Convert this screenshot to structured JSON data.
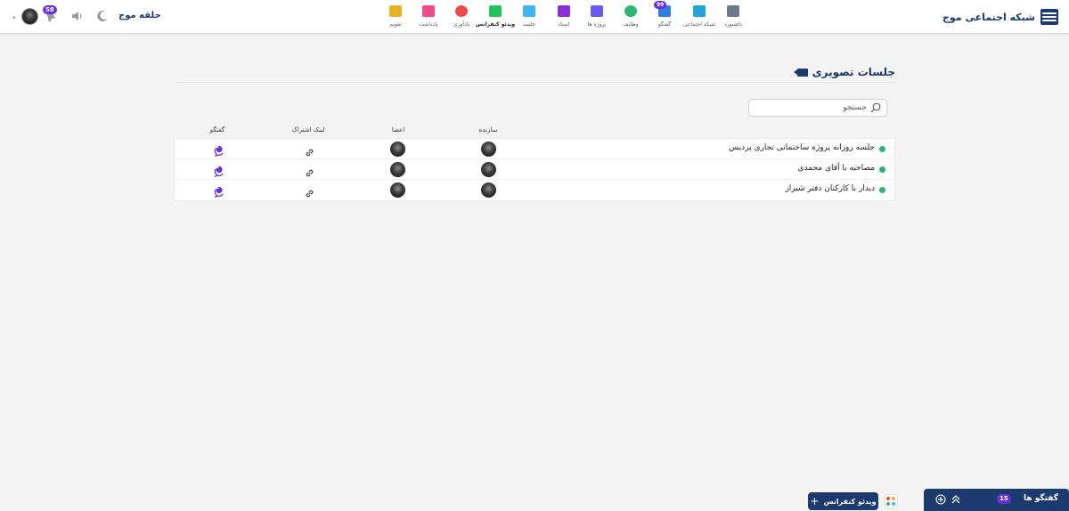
{
  "brand": {
    "name": "شبکه اجتماعی موج",
    "color": "#1d3a6e"
  },
  "header": {
    "circle_name": "حلقه موج",
    "notifications_count": "58",
    "nav": [
      {
        "key": "dashboard",
        "label": "داشبورد",
        "color": "#6b7a8c",
        "bold": false,
        "badge": ""
      },
      {
        "key": "social",
        "label": "شبکه اجتماعی",
        "color": "#1fa6d6",
        "bold": false,
        "badge": ""
      },
      {
        "key": "chat",
        "label": "گفتگو",
        "color": "#2f7de1",
        "bold": false,
        "badge": "99"
      },
      {
        "key": "tasks",
        "label": "وظایف",
        "color": "#2bb673",
        "bold": false,
        "badge": ""
      },
      {
        "key": "projects",
        "label": "پروژه ها",
        "color": "#6a5cf0",
        "bold": false,
        "badge": ""
      },
      {
        "key": "documents",
        "label": "اسناد",
        "color": "#8b2fd8",
        "bold": false,
        "badge": ""
      },
      {
        "key": "meeting",
        "label": "جلسه",
        "color": "#3eb5f1",
        "bold": false,
        "badge": ""
      },
      {
        "key": "videoconference",
        "label": "ویدئو کنفرانس",
        "color": "#22c35e",
        "bold": true,
        "badge": ""
      },
      {
        "key": "reminder",
        "label": "یادآوری",
        "color": "#ef4b4b",
        "bold": false,
        "badge": ""
      },
      {
        "key": "notes",
        "label": "یادداشت",
        "color": "#ee4d8c",
        "bold": false,
        "badge": ""
      },
      {
        "key": "calendar",
        "label": "تقویم",
        "color": "#e6b422",
        "bold": false,
        "badge": ""
      }
    ]
  },
  "page": {
    "title": "جلسات تصویری",
    "search_placeholder": "جستجو",
    "columns": {
      "creator": "سازنده",
      "members": "اعضا",
      "share_link": "لینک اشتراک",
      "chat": "گفتگو"
    },
    "rows": [
      {
        "title": "جلسه روزانه پروژه ساختمانی تجاری پردیس",
        "chat_count": "1"
      },
      {
        "title": "مصاحبه با آقای محمدی",
        "chat_count": "1"
      },
      {
        "title": "دیدار با کارکنان دفتر شیراز",
        "chat_count": "1"
      }
    ]
  },
  "footer": {
    "new_videoconference_label": "ویدئو کنفرانس",
    "chats_label": "گفتگو ها",
    "chats_count": "15"
  },
  "colors": {
    "accent": "#6a2fd8",
    "status_active": "#2bb673",
    "primary": "#1d3a6e"
  }
}
